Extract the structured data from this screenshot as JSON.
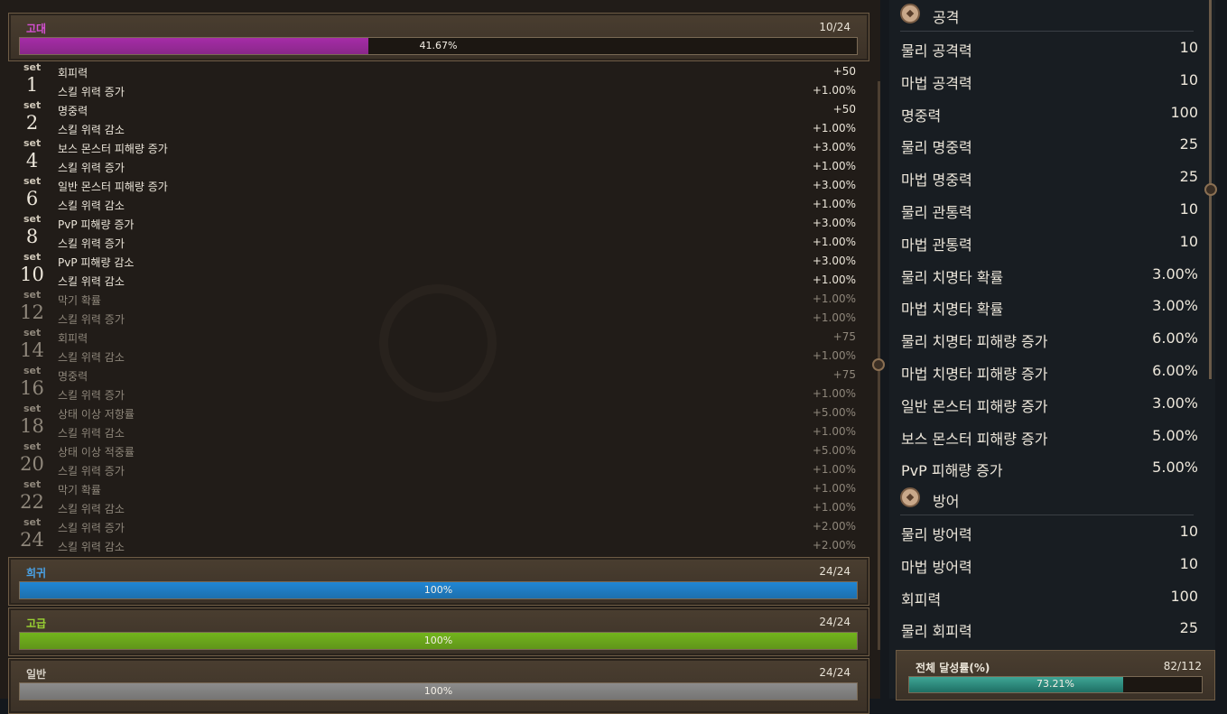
{
  "tiers": [
    {
      "name": "고대",
      "count": "10/24",
      "percent_text": "41.67%",
      "progress": 0.4167,
      "name_color": "#d54fd3",
      "bar_color": "#a52ca7"
    },
    {
      "name": "희귀",
      "count": "24/24",
      "percent_text": "100%",
      "progress": 1.0,
      "name_color": "#4aa3e8",
      "bar_color": "#1f86d4"
    },
    {
      "name": "고급",
      "count": "24/24",
      "percent_text": "100%",
      "progress": 1.0,
      "name_color": "#9bd433",
      "bar_color": "#72b51c"
    },
    {
      "name": "일반",
      "count": "24/24",
      "percent_text": "100%",
      "progress": 1.0,
      "name_color": "#d6d0c6",
      "bar_color": "#8c8c8c"
    }
  ],
  "set_tag": "set",
  "sets": [
    {
      "num": "1",
      "active": true,
      "effects": [
        {
          "name": "회피력",
          "value": "+50"
        },
        {
          "name": "스킬 위력 증가",
          "value": "+1.00%"
        }
      ]
    },
    {
      "num": "2",
      "active": true,
      "effects": [
        {
          "name": "명중력",
          "value": "+50"
        },
        {
          "name": "스킬 위력 감소",
          "value": "+1.00%"
        }
      ]
    },
    {
      "num": "4",
      "active": true,
      "effects": [
        {
          "name": "보스 몬스터 피해량 증가",
          "value": "+3.00%"
        },
        {
          "name": "스킬 위력 증가",
          "value": "+1.00%"
        }
      ]
    },
    {
      "num": "6",
      "active": true,
      "effects": [
        {
          "name": "일반 몬스터 피해량 증가",
          "value": "+3.00%"
        },
        {
          "name": "스킬 위력 감소",
          "value": "+1.00%"
        }
      ]
    },
    {
      "num": "8",
      "active": true,
      "effects": [
        {
          "name": "PvP 피해량 증가",
          "value": "+3.00%"
        },
        {
          "name": "스킬 위력 증가",
          "value": "+1.00%"
        }
      ]
    },
    {
      "num": "10",
      "active": true,
      "effects": [
        {
          "name": "PvP 피해량 감소",
          "value": "+3.00%"
        },
        {
          "name": "스킬 위력 감소",
          "value": "+1.00%"
        }
      ]
    },
    {
      "num": "12",
      "active": false,
      "effects": [
        {
          "name": "막기 확률",
          "value": "+1.00%"
        },
        {
          "name": "스킬 위력 증가",
          "value": "+1.00%"
        }
      ]
    },
    {
      "num": "14",
      "active": false,
      "effects": [
        {
          "name": "회피력",
          "value": "+75"
        },
        {
          "name": "스킬 위력 감소",
          "value": "+1.00%"
        }
      ]
    },
    {
      "num": "16",
      "active": false,
      "effects": [
        {
          "name": "명중력",
          "value": "+75"
        },
        {
          "name": "스킬 위력 증가",
          "value": "+1.00%"
        }
      ]
    },
    {
      "num": "18",
      "active": false,
      "effects": [
        {
          "name": "상태 이상 저항률",
          "value": "+5.00%"
        },
        {
          "name": "스킬 위력 감소",
          "value": "+1.00%"
        }
      ]
    },
    {
      "num": "20",
      "active": false,
      "effects": [
        {
          "name": "상태 이상 적중률",
          "value": "+5.00%"
        },
        {
          "name": "스킬 위력 증가",
          "value": "+1.00%"
        }
      ]
    },
    {
      "num": "22",
      "active": false,
      "effects": [
        {
          "name": "막기 확률",
          "value": "+1.00%"
        },
        {
          "name": "스킬 위력 감소",
          "value": "+1.00%"
        }
      ]
    },
    {
      "num": "24",
      "active": false,
      "effects": [
        {
          "name": "스킬 위력 증가",
          "value": "+2.00%"
        },
        {
          "name": "스킬 위력 감소",
          "value": "+2.00%"
        }
      ]
    }
  ],
  "attack": {
    "label": "공격",
    "stats": [
      {
        "name": "물리 공격력",
        "value": "10"
      },
      {
        "name": "마법 공격력",
        "value": "10"
      },
      {
        "name": "명중력",
        "value": "100"
      },
      {
        "name": "물리 명중력",
        "value": "25"
      },
      {
        "name": "마법 명중력",
        "value": "25"
      },
      {
        "name": "물리 관통력",
        "value": "10"
      },
      {
        "name": "마법 관통력",
        "value": "10"
      },
      {
        "name": "물리 치명타 확률",
        "value": "3.00%"
      },
      {
        "name": "마법 치명타 확률",
        "value": "3.00%"
      },
      {
        "name": "물리 치명타 피해량 증가",
        "value": "6.00%"
      },
      {
        "name": "마법 치명타 피해량 증가",
        "value": "6.00%"
      },
      {
        "name": "일반 몬스터 피해량 증가",
        "value": "3.00%"
      },
      {
        "name": "보스 몬스터 피해량 증가",
        "value": "5.00%"
      },
      {
        "name": "PvP 피해량 증가",
        "value": "5.00%"
      }
    ]
  },
  "defense": {
    "label": "방어",
    "stats": [
      {
        "name": "물리 방어력",
        "value": "10"
      },
      {
        "name": "마법 방어력",
        "value": "10"
      },
      {
        "name": "회피력",
        "value": "100"
      },
      {
        "name": "물리 회피력",
        "value": "25"
      }
    ]
  },
  "total": {
    "label": "전체 달성률(%)",
    "count": "82/112",
    "percent_text": "73.21%",
    "progress": 0.7321
  }
}
